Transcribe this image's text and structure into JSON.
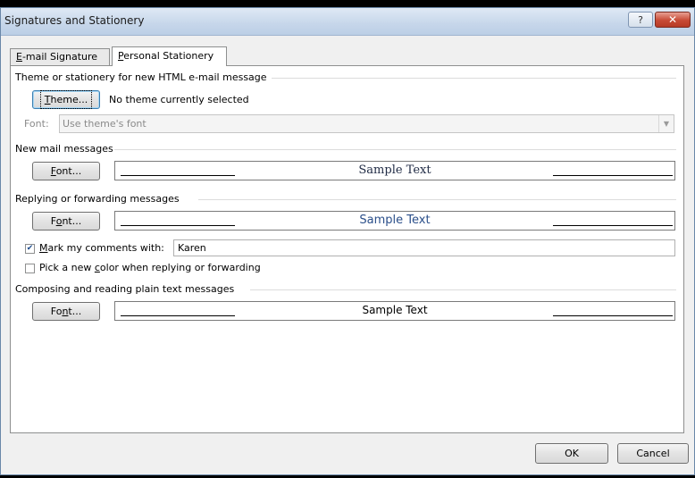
{
  "window": {
    "title": "Signatures and Stationery",
    "help_glyph": "?",
    "close_glyph": "✕"
  },
  "tabs": [
    {
      "label": "E-mail Signature",
      "accel": "E",
      "rest": "-mail Signature",
      "active": false
    },
    {
      "label": "Personal Stationery",
      "accel": "P",
      "rest": "ersonal Stationery",
      "active": true
    }
  ],
  "theme_section": {
    "group_label": "Theme or stationery for new HTML e-mail message",
    "theme_button": {
      "label": "Theme...",
      "accel": "T",
      "rest": "heme..."
    },
    "theme_status": "No theme currently selected",
    "font_label": "Font:",
    "font_combo_value": "Use theme's font"
  },
  "new_mail": {
    "group_label": "New mail messages",
    "font_button": {
      "label": "Font...",
      "accel": "F",
      "rest": "ont..."
    },
    "sample_text": "Sample Text"
  },
  "reply": {
    "group_label": "Replying or forwarding messages",
    "font_button": {
      "label": "Font...",
      "pre": "F",
      "accel": "o",
      "rest": "nt..."
    },
    "sample_text": "Sample Text",
    "mark_comments": {
      "checked": true,
      "label": "Mark my comments with:",
      "accel": "M",
      "rest": "ark my comments with:",
      "value": "Karen"
    },
    "pick_color": {
      "checked": false,
      "label": "Pick a new color when replying or forwarding",
      "pre": "Pick a new ",
      "accel": "c",
      "rest": "olor when replying or forwarding"
    }
  },
  "plain_text": {
    "group_label": "Composing and reading plain text messages",
    "font_button": {
      "label": "Font...",
      "pre": "Fo",
      "accel": "n",
      "rest": "t..."
    },
    "sample_text": "Sample Text"
  },
  "footer": {
    "ok_label": "OK",
    "cancel_label": "Cancel"
  },
  "icons": {
    "help": "help-icon",
    "close": "close-icon",
    "dropdown": "chevron-down-icon",
    "check": "checkmark-icon"
  },
  "colors": {
    "title_bar": "#c6d6ea",
    "close_button": "#c74a35",
    "sample_blue": "#2b4f8a"
  }
}
